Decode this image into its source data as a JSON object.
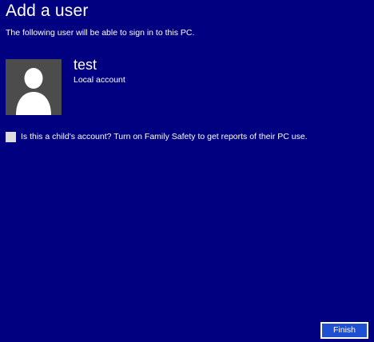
{
  "header": {
    "title": "Add a user",
    "subtitle": "The following user will be able to sign in to this PC."
  },
  "user": {
    "name": "test",
    "account_type": "Local account",
    "avatar_icon": "user-silhouette-icon"
  },
  "options": {
    "child_account_label": "Is this a child's account? Turn on Family Safety to get reports of their PC use.",
    "child_account_checked": false
  },
  "footer": {
    "finish_label": "Finish"
  },
  "colors": {
    "background": "#000080",
    "avatar_background": "#4c4c4c",
    "button_background": "#1f50d2",
    "text": "#ffffff"
  }
}
